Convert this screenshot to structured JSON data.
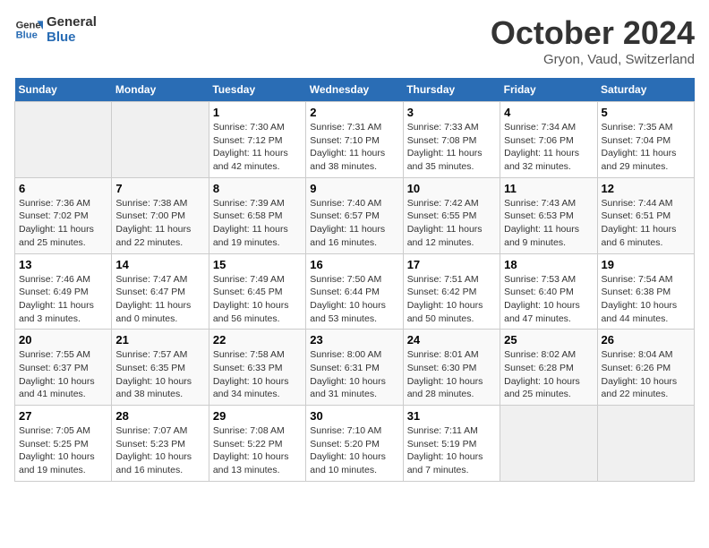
{
  "header": {
    "logo_line1": "General",
    "logo_line2": "Blue",
    "month_title": "October 2024",
    "location": "Gryon, Vaud, Switzerland"
  },
  "weekdays": [
    "Sunday",
    "Monday",
    "Tuesday",
    "Wednesday",
    "Thursday",
    "Friday",
    "Saturday"
  ],
  "weeks": [
    [
      {
        "day": "",
        "sunrise": "",
        "sunset": "",
        "daylight": ""
      },
      {
        "day": "",
        "sunrise": "",
        "sunset": "",
        "daylight": ""
      },
      {
        "day": "1",
        "sunrise": "Sunrise: 7:30 AM",
        "sunset": "Sunset: 7:12 PM",
        "daylight": "Daylight: 11 hours and 42 minutes."
      },
      {
        "day": "2",
        "sunrise": "Sunrise: 7:31 AM",
        "sunset": "Sunset: 7:10 PM",
        "daylight": "Daylight: 11 hours and 38 minutes."
      },
      {
        "day": "3",
        "sunrise": "Sunrise: 7:33 AM",
        "sunset": "Sunset: 7:08 PM",
        "daylight": "Daylight: 11 hours and 35 minutes."
      },
      {
        "day": "4",
        "sunrise": "Sunrise: 7:34 AM",
        "sunset": "Sunset: 7:06 PM",
        "daylight": "Daylight: 11 hours and 32 minutes."
      },
      {
        "day": "5",
        "sunrise": "Sunrise: 7:35 AM",
        "sunset": "Sunset: 7:04 PM",
        "daylight": "Daylight: 11 hours and 29 minutes."
      }
    ],
    [
      {
        "day": "6",
        "sunrise": "Sunrise: 7:36 AM",
        "sunset": "Sunset: 7:02 PM",
        "daylight": "Daylight: 11 hours and 25 minutes."
      },
      {
        "day": "7",
        "sunrise": "Sunrise: 7:38 AM",
        "sunset": "Sunset: 7:00 PM",
        "daylight": "Daylight: 11 hours and 22 minutes."
      },
      {
        "day": "8",
        "sunrise": "Sunrise: 7:39 AM",
        "sunset": "Sunset: 6:58 PM",
        "daylight": "Daylight: 11 hours and 19 minutes."
      },
      {
        "day": "9",
        "sunrise": "Sunrise: 7:40 AM",
        "sunset": "Sunset: 6:57 PM",
        "daylight": "Daylight: 11 hours and 16 minutes."
      },
      {
        "day": "10",
        "sunrise": "Sunrise: 7:42 AM",
        "sunset": "Sunset: 6:55 PM",
        "daylight": "Daylight: 11 hours and 12 minutes."
      },
      {
        "day": "11",
        "sunrise": "Sunrise: 7:43 AM",
        "sunset": "Sunset: 6:53 PM",
        "daylight": "Daylight: 11 hours and 9 minutes."
      },
      {
        "day": "12",
        "sunrise": "Sunrise: 7:44 AM",
        "sunset": "Sunset: 6:51 PM",
        "daylight": "Daylight: 11 hours and 6 minutes."
      }
    ],
    [
      {
        "day": "13",
        "sunrise": "Sunrise: 7:46 AM",
        "sunset": "Sunset: 6:49 PM",
        "daylight": "Daylight: 11 hours and 3 minutes."
      },
      {
        "day": "14",
        "sunrise": "Sunrise: 7:47 AM",
        "sunset": "Sunset: 6:47 PM",
        "daylight": "Daylight: 11 hours and 0 minutes."
      },
      {
        "day": "15",
        "sunrise": "Sunrise: 7:49 AM",
        "sunset": "Sunset: 6:45 PM",
        "daylight": "Daylight: 10 hours and 56 minutes."
      },
      {
        "day": "16",
        "sunrise": "Sunrise: 7:50 AM",
        "sunset": "Sunset: 6:44 PM",
        "daylight": "Daylight: 10 hours and 53 minutes."
      },
      {
        "day": "17",
        "sunrise": "Sunrise: 7:51 AM",
        "sunset": "Sunset: 6:42 PM",
        "daylight": "Daylight: 10 hours and 50 minutes."
      },
      {
        "day": "18",
        "sunrise": "Sunrise: 7:53 AM",
        "sunset": "Sunset: 6:40 PM",
        "daylight": "Daylight: 10 hours and 47 minutes."
      },
      {
        "day": "19",
        "sunrise": "Sunrise: 7:54 AM",
        "sunset": "Sunset: 6:38 PM",
        "daylight": "Daylight: 10 hours and 44 minutes."
      }
    ],
    [
      {
        "day": "20",
        "sunrise": "Sunrise: 7:55 AM",
        "sunset": "Sunset: 6:37 PM",
        "daylight": "Daylight: 10 hours and 41 minutes."
      },
      {
        "day": "21",
        "sunrise": "Sunrise: 7:57 AM",
        "sunset": "Sunset: 6:35 PM",
        "daylight": "Daylight: 10 hours and 38 minutes."
      },
      {
        "day": "22",
        "sunrise": "Sunrise: 7:58 AM",
        "sunset": "Sunset: 6:33 PM",
        "daylight": "Daylight: 10 hours and 34 minutes."
      },
      {
        "day": "23",
        "sunrise": "Sunrise: 8:00 AM",
        "sunset": "Sunset: 6:31 PM",
        "daylight": "Daylight: 10 hours and 31 minutes."
      },
      {
        "day": "24",
        "sunrise": "Sunrise: 8:01 AM",
        "sunset": "Sunset: 6:30 PM",
        "daylight": "Daylight: 10 hours and 28 minutes."
      },
      {
        "day": "25",
        "sunrise": "Sunrise: 8:02 AM",
        "sunset": "Sunset: 6:28 PM",
        "daylight": "Daylight: 10 hours and 25 minutes."
      },
      {
        "day": "26",
        "sunrise": "Sunrise: 8:04 AM",
        "sunset": "Sunset: 6:26 PM",
        "daylight": "Daylight: 10 hours and 22 minutes."
      }
    ],
    [
      {
        "day": "27",
        "sunrise": "Sunrise: 7:05 AM",
        "sunset": "Sunset: 5:25 PM",
        "daylight": "Daylight: 10 hours and 19 minutes."
      },
      {
        "day": "28",
        "sunrise": "Sunrise: 7:07 AM",
        "sunset": "Sunset: 5:23 PM",
        "daylight": "Daylight: 10 hours and 16 minutes."
      },
      {
        "day": "29",
        "sunrise": "Sunrise: 7:08 AM",
        "sunset": "Sunset: 5:22 PM",
        "daylight": "Daylight: 10 hours and 13 minutes."
      },
      {
        "day": "30",
        "sunrise": "Sunrise: 7:10 AM",
        "sunset": "Sunset: 5:20 PM",
        "daylight": "Daylight: 10 hours and 10 minutes."
      },
      {
        "day": "31",
        "sunrise": "Sunrise: 7:11 AM",
        "sunset": "Sunset: 5:19 PM",
        "daylight": "Daylight: 10 hours and 7 minutes."
      },
      {
        "day": "",
        "sunrise": "",
        "sunset": "",
        "daylight": ""
      },
      {
        "day": "",
        "sunrise": "",
        "sunset": "",
        "daylight": ""
      }
    ]
  ]
}
